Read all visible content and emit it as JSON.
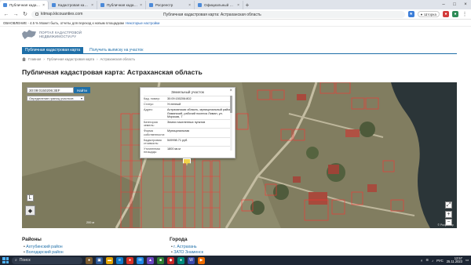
{
  "browser": {
    "tabs": [
      {
        "label": "Публичная кадастровая",
        "active": true
      },
      {
        "label": "Кадастровая карта",
        "active": false
      },
      {
        "label": "Публичная кадастровая",
        "active": false
      },
      {
        "label": "Росреестр",
        "active": false
      },
      {
        "label": "Официальный сайт",
        "active": false
      }
    ],
    "url": "kitmap.kkcouanties.com",
    "page_title": "Публичная кадастровая карта: Астраханская область",
    "profile_label": "Шторка"
  },
  "bookmarks": {
    "notice": "ОБНОВЛЕНИЕ - 4.5 % Может быть, отчеты для переход к новым площадкам",
    "link": "Некоторые настройки"
  },
  "site": {
    "logo_line1": "ПОРТАЛ КАДАСТРОВОЙ",
    "logo_line2": "НЕДВИЖИМОСТИ.РУ",
    "tab_active": "Публичная кадастровая карта",
    "tab_link": "Получить выписку на участок",
    "breadcrumb": [
      "Главная",
      "Публичная кадастровая карта",
      "Астраханская область"
    ],
    "title": "Публичная кадастровая карта: Астраханская область"
  },
  "map": {
    "search_value": "30:09:0150206:3EF",
    "search_button": "Найти",
    "layer_select": "Определение границ участков",
    "scale_label": "200 м",
    "attribution": "© Росреестр",
    "popup": {
      "title": "Земельный участок",
      "rows": [
        {
          "key": "Кад. номер:",
          "value": "30:09:150206:802"
        },
        {
          "key": "Статус:",
          "value": "Учтенный"
        },
        {
          "key": "Адрес:",
          "value": "Астраханская область, муниципальный район Лиманский, рабочий поселок Лиман, ул. Морская, 7"
        },
        {
          "key": "Категория земель:",
          "value": "Земли населенных пунктов"
        },
        {
          "key": "Форма собственности:",
          "value": "Муниципальная"
        },
        {
          "key": "Кадастровая стоимость:",
          "value": "549998.71 руб."
        },
        {
          "key": "Уточненная площадь:",
          "value": "1800 кв.м"
        }
      ]
    }
  },
  "sections": {
    "regions_title": "Районы",
    "regions": [
      "Ахтубинский район",
      "Володарский район"
    ],
    "cities_title": "Города",
    "cities": [
      "г. Астрахань",
      "ЗАТО Знаменск"
    ]
  },
  "taskbar": {
    "search_placeholder": "Поиск",
    "time": "12:57",
    "date": "25.11.2023",
    "lang": "РУС"
  },
  "colors": {
    "accent": "#1f6fa8",
    "taskbar": "#1d2634",
    "parcel_outline": "#ff3030"
  }
}
